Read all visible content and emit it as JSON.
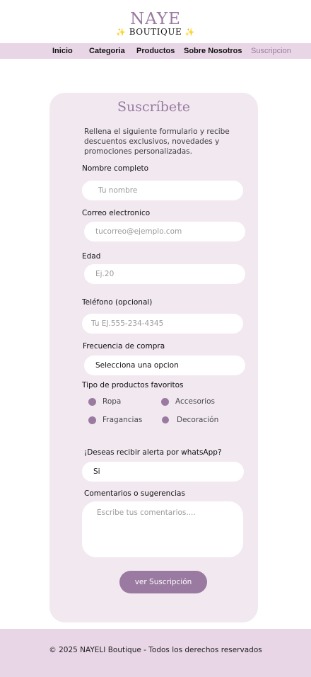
{
  "brand": {
    "name_top": "NAYE",
    "name_bottom": "BOUTIQUE",
    "sparkle": "✨"
  },
  "nav": {
    "items": [
      {
        "label": "Inicio"
      },
      {
        "label": "Categoria"
      },
      {
        "label": "Productos"
      },
      {
        "label": "Sobre Nosotros"
      },
      {
        "label": "Suscripcion",
        "active": true
      }
    ]
  },
  "form": {
    "title": "Suscríbete",
    "intro": "Rellena el siguiente formulario y recibe descuentos exclusivos, novedades y promociones personalizadas.",
    "name": {
      "label": "Nombre completo",
      "placeholder": "Tu nombre"
    },
    "email": {
      "label": "Correo electronico",
      "placeholder": "tucorreo@ejemplo.com"
    },
    "age": {
      "label": "Edad",
      "placeholder": "Ej.20"
    },
    "phone": {
      "label": "Teléfono (opcional)",
      "placeholder": "Tu EJ.555-234-4345"
    },
    "frequency": {
      "label": "Frecuencia de compra",
      "value": "Selecciona una opcion"
    },
    "favorites": {
      "label": "Tipo de productos favoritos",
      "options": [
        "Ropa",
        "Accesorios",
        "Fragancias",
        "Decoración"
      ]
    },
    "whatsapp": {
      "label": "¡Deseas recibir alerta por whatsApp?",
      "value": "Si"
    },
    "comments": {
      "label": "Comentarios o sugerencias",
      "placeholder": "Escribe tus comentarios...."
    },
    "submit_label": "ver Suscripción"
  },
  "footer": {
    "text": "© 2025 NAYELI Boutique - Todos los derechos reservados"
  },
  "colors": {
    "accent": "#9a7aa0",
    "nav_bg": "#e8d6e6",
    "card_bg": "#f1e8f0"
  }
}
